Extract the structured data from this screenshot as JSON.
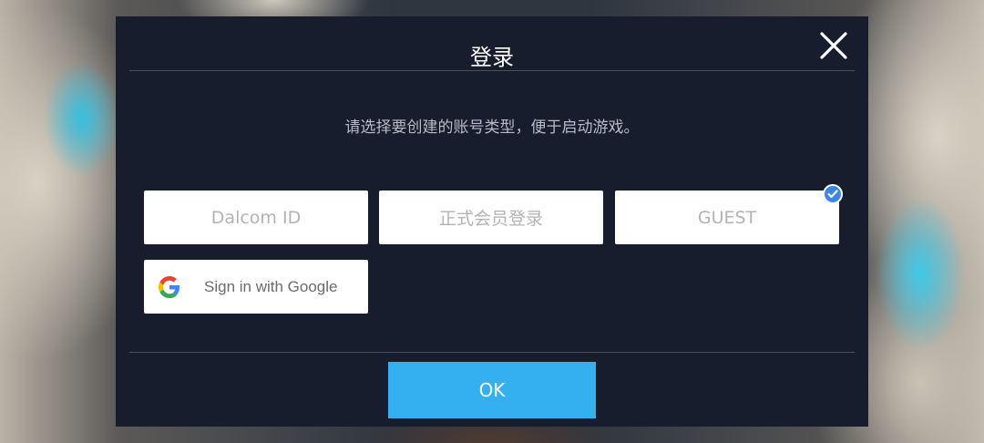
{
  "dialog": {
    "title": "登录",
    "prompt": "请选择要创建的账号类型，便于启动游戏。",
    "options": [
      {
        "label": "Dalcom ID",
        "selected": false
      },
      {
        "label": "正式会员登录",
        "selected": false
      },
      {
        "label": "GUEST",
        "selected": true
      }
    ],
    "google_label": "Sign in with Google",
    "ok_label": "OK",
    "icons": {
      "close": "close-icon",
      "check": "checkmark-icon",
      "google": "google-logo-icon"
    },
    "colors": {
      "dialog_bg": "#171d2d",
      "ok_button": "#34b0f1",
      "check_badge": "#3b86e6"
    }
  }
}
